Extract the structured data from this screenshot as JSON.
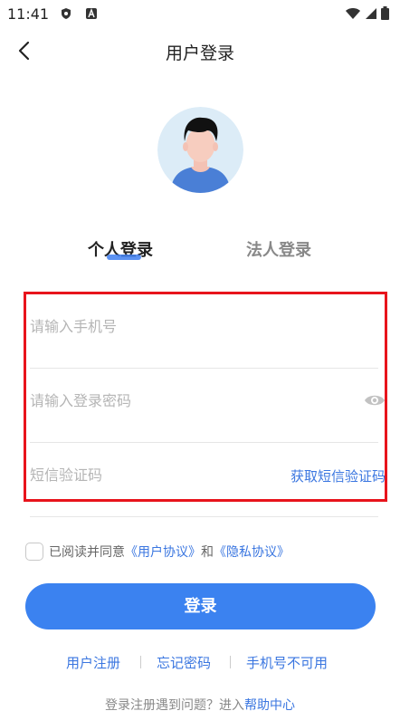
{
  "status": {
    "time": "11:41",
    "icons": [
      "shield-app-icon",
      "font-app-icon",
      "wifi-icon",
      "signal-icon",
      "battery-icon"
    ]
  },
  "nav": {
    "title": "用户登录",
    "back_icon": "chevron-left-icon"
  },
  "tabs": [
    {
      "label": "个人登录",
      "active": true
    },
    {
      "label": "法人登录",
      "active": false
    }
  ],
  "form": {
    "phone_placeholder": "请输入手机号",
    "password_placeholder": "请输入登录密码",
    "sms_placeholder": "短信验证码",
    "sms_button": "获取短信验证码",
    "eye_icon": "eye-icon"
  },
  "agreement": {
    "prefix": "已阅读并同意",
    "user_agreement": "《用户协议》",
    "and": "和",
    "privacy_agreement": "《隐私协议》",
    "checked": false
  },
  "login_button": "登录",
  "links": {
    "register": "用户注册",
    "forgot": "忘记密码",
    "phone_unavailable": "手机号不可用"
  },
  "help": {
    "prefix": "登录注册遇到问题？进入",
    "link": "帮助中心"
  },
  "colors": {
    "accent": "#3b82f0",
    "link": "#3a76e0",
    "highlight_border": "#e8141c"
  }
}
